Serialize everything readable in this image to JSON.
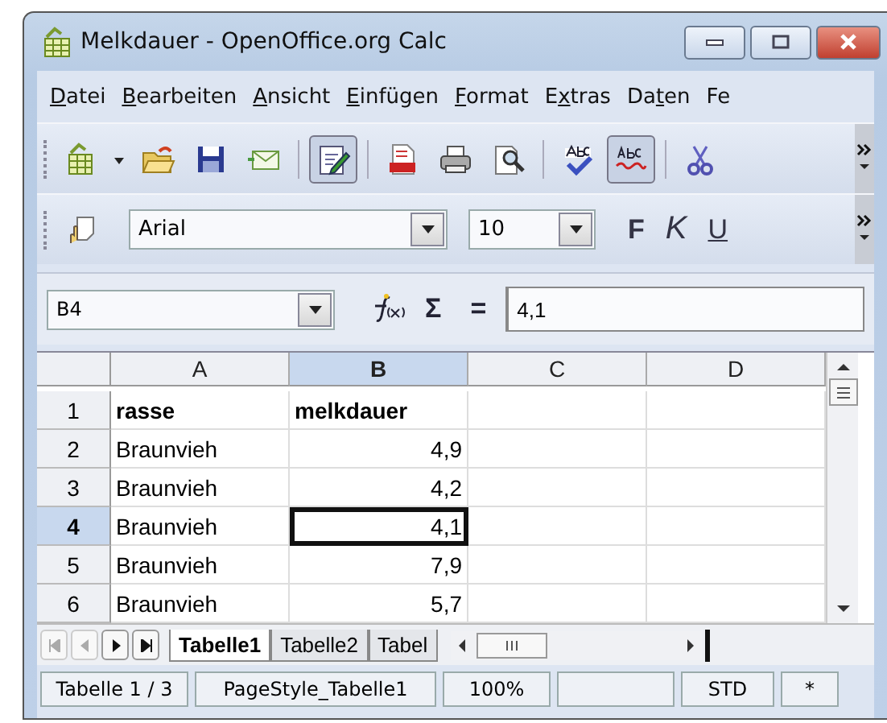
{
  "window": {
    "title": "Melkdauer - OpenOffice.org Calc"
  },
  "menu": [
    {
      "key": "D",
      "post": "atei"
    },
    {
      "key": "B",
      "post": "earbeiten"
    },
    {
      "key": "A",
      "post": "nsicht"
    },
    {
      "key": "E",
      "post": "infügen"
    },
    {
      "key": "F",
      "post": "ormat"
    },
    {
      "pre": "E",
      "key": "x",
      "post": "tras"
    },
    {
      "pre": "Da",
      "key": "t",
      "post": "en"
    },
    {
      "pre": "Fe"
    }
  ],
  "toolbar": [
    {
      "kind": "new"
    },
    {
      "kind": "dropdown"
    },
    {
      "kind": "open"
    },
    {
      "kind": "save"
    },
    {
      "kind": "mail"
    },
    {
      "kind": "edit",
      "pressed": true
    },
    {
      "kind": "pdf"
    },
    {
      "kind": "print"
    },
    {
      "kind": "preview"
    },
    {
      "kind": "spell"
    },
    {
      "kind": "autospell",
      "pressed": true
    },
    {
      "kind": "cut"
    }
  ],
  "format_bar": {
    "font": "Arial",
    "size": "10",
    "bold": "F",
    "italic": "K",
    "underline": "U"
  },
  "formula_bar": {
    "cell": "B4",
    "sum": "Σ",
    "equals": "=",
    "value": "4,1"
  },
  "columns": [
    {
      "label": "A",
      "selected": false
    },
    {
      "label": "B",
      "selected": true
    },
    {
      "label": "C",
      "selected": false
    },
    {
      "label": "D",
      "selected": false
    }
  ],
  "rows": [
    {
      "number": "1",
      "selected": false,
      "cells": [
        "rasse",
        "melkdauer"
      ]
    },
    {
      "number": "2",
      "selected": false,
      "cells": [
        "Braunvieh",
        "4,9"
      ]
    },
    {
      "number": "3",
      "selected": false,
      "cells": [
        "Braunvieh",
        "4,2"
      ]
    },
    {
      "number": "4",
      "selected": true,
      "cells": [
        "Braunvieh",
        "4,1"
      ]
    },
    {
      "number": "5",
      "selected": false,
      "cells": [
        "Braunvieh",
        "7,9"
      ]
    },
    {
      "number": "6",
      "selected": false,
      "cells": [
        "Braunvieh",
        "5,7"
      ]
    }
  ],
  "sheet_tabs": [
    {
      "label": "Tabelle1",
      "selected": true
    },
    {
      "label": "Tabelle2",
      "selected": false
    },
    {
      "label": "Tabel",
      "selected": false
    }
  ],
  "status_bar": [
    "Tabelle 1 / 3",
    "PageStyle_Tabelle1",
    "100%",
    "STD",
    "*"
  ]
}
